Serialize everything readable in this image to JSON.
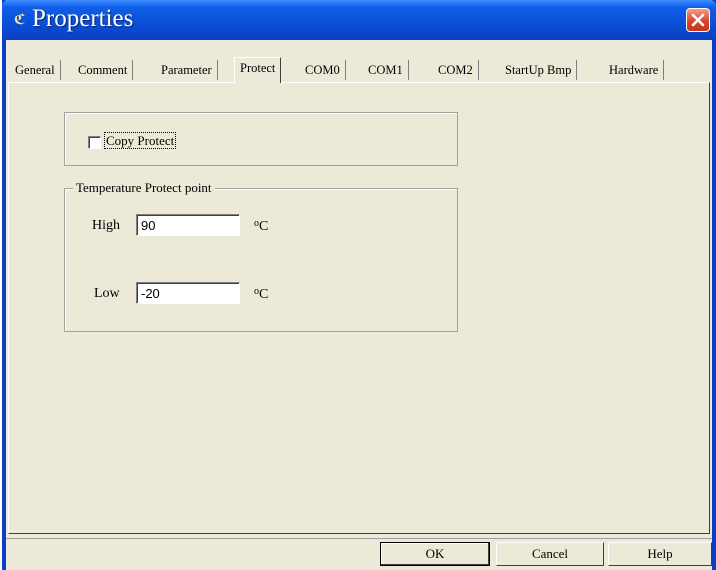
{
  "window": {
    "title": "Properties",
    "app_icon": "app-icon",
    "close_icon": "close-icon"
  },
  "tabs": [
    {
      "label": "General"
    },
    {
      "label": "Comment"
    },
    {
      "label": "Parameter"
    },
    {
      "label": "Protect",
      "active": true
    },
    {
      "label": "COM0"
    },
    {
      "label": "COM1"
    },
    {
      "label": "COM2"
    },
    {
      "label": "StartUp Bmp"
    },
    {
      "label": "Hardware"
    }
  ],
  "protect": {
    "copy_protect_label": "Copy Protect",
    "copy_protect_checked": false,
    "temperature_group_title": "Temperature Protect point",
    "high_label": "High",
    "high_value": "90",
    "low_label": "Low",
    "low_value": "-20",
    "unit_degree": "o",
    "unit_letter": "C"
  },
  "buttons": {
    "ok": "OK",
    "cancel": "Cancel",
    "help": "Help"
  },
  "colors": {
    "titlebar": "#0a4ed6",
    "window_bg": "#ece9d8",
    "close_button": "#d9462a"
  }
}
